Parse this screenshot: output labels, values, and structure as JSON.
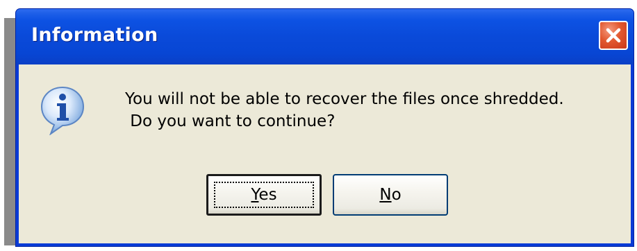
{
  "dialog": {
    "title": "Information",
    "message_line1": "You will not be able to recover the files once shredded.",
    "message_line2": " Do you want to continue?",
    "icon": "information-icon",
    "close_icon": "close-icon",
    "buttons": {
      "yes": {
        "mnemonic": "Y",
        "rest": "es",
        "label": "Yes"
      },
      "no": {
        "mnemonic": "N",
        "rest": "o",
        "label": "No"
      }
    }
  },
  "colors": {
    "titlebar": "#0a4ad9",
    "client": "#ece9d8",
    "close_button": "#e2582f"
  }
}
